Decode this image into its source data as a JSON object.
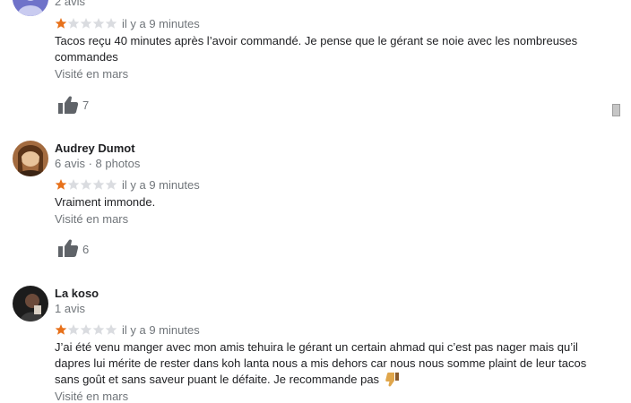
{
  "reviews": [
    {
      "meta": "2 avis",
      "rating": 1,
      "rating_max": 5,
      "time": "il y a 9 minutes",
      "text": "Tacos reçu 40 minutes après l’avoir commandé. Je pense que le gérant se noie avec les nombreuses commandes",
      "visited": "Visité en mars",
      "likes": "7"
    },
    {
      "name": "Audrey Dumot",
      "meta": "6 avis · 8 photos",
      "rating": 1,
      "rating_max": 5,
      "time": "il y a 9 minutes",
      "text": "Vraiment immonde.",
      "visited": "Visité en mars",
      "likes": "6"
    },
    {
      "name": "La koso",
      "meta": "1 avis",
      "rating": 1,
      "rating_max": 5,
      "time": "il y a 9 minutes",
      "text": "J’ai été venu manger avec mon amis tehuira le gérant un certain ahmad qui c’est pas nager mais qu’il dapres lui mérite de rester dans koh lanta nous a mis dehors car nous nous somme plaint de leur tacos sans goût et sans saveur puant le défaite.  Je recommande pas",
      "text_emoji": "thumbs-down-emoji",
      "visited": "Visité en mars"
    }
  ],
  "colors": {
    "star_filled": "#e7711b",
    "star_empty": "#dadce0",
    "like_icon": "#5f6368"
  },
  "scrollbar": {
    "icon": "scrollbar-thumb"
  }
}
